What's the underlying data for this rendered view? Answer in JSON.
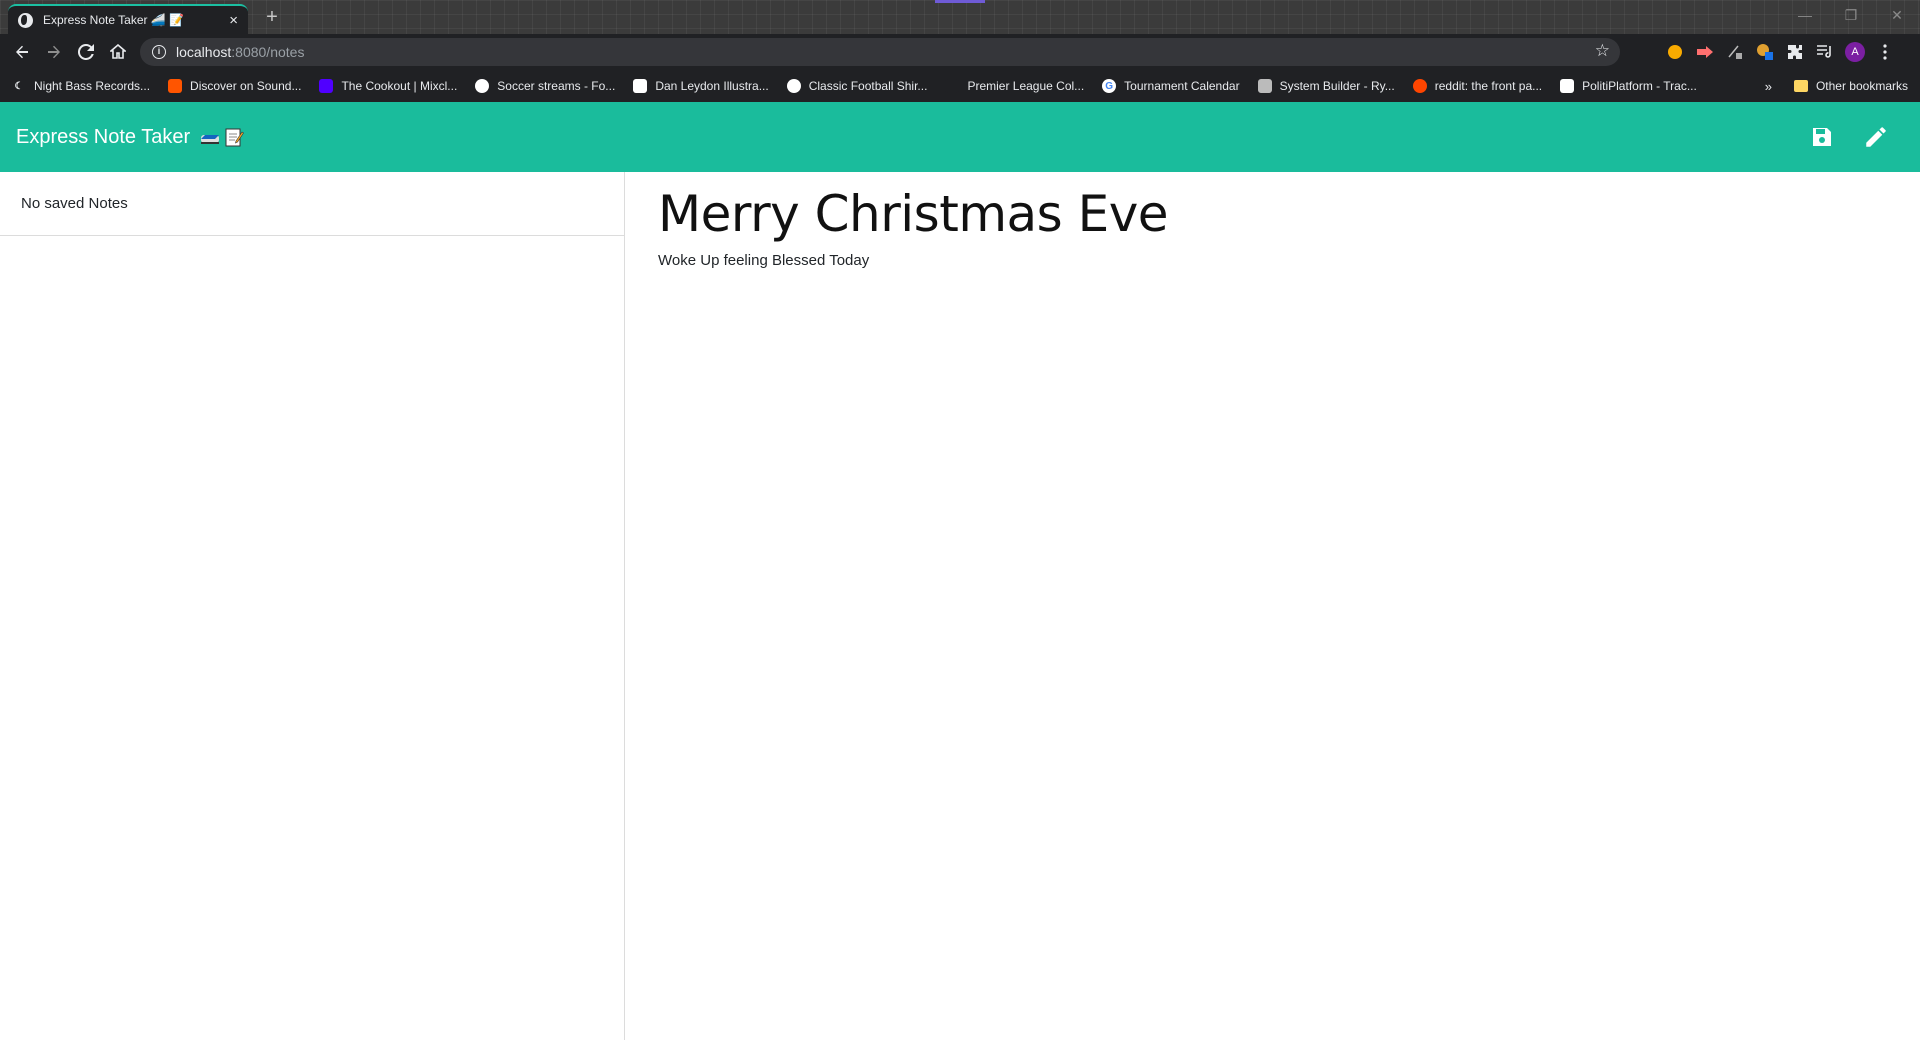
{
  "browser": {
    "tab_title": "Express Note Taker 🚄 📝",
    "new_tab": "+",
    "tab_close": "×",
    "window_controls": [
      "—",
      "❐",
      "✕"
    ],
    "url_host": "localhost",
    "url_path": ":8080/notes",
    "bookmarks": [
      {
        "label": "Night Bass Records...",
        "icon": "moon-icon",
        "color": "#202124"
      },
      {
        "label": "Discover on Sound...",
        "icon": "soundcloud-icon",
        "color": "#ff5500"
      },
      {
        "label": "The Cookout | Mixcl...",
        "icon": "mixcloud-icon",
        "color": "#5000ff"
      },
      {
        "label": "Soccer streams - Fo...",
        "icon": "reddit-ball-icon",
        "color": "#ffffff"
      },
      {
        "label": "Dan Leydon Illustra...",
        "icon": "page-icon",
        "color": "#ffffff"
      },
      {
        "label": "Classic Football Shir...",
        "icon": "football-icon",
        "color": "#ffffff"
      },
      {
        "label": "Premier League Col...",
        "icon": "blank-icon",
        "color": "#202124"
      },
      {
        "label": "Tournament Calendar",
        "icon": "google-icon",
        "color": "#ffffff"
      },
      {
        "label": "System Builder - Ry...",
        "icon": "cube-icon",
        "color": "#bbbbbb"
      },
      {
        "label": "reddit: the front pa...",
        "icon": "reddit-icon",
        "color": "#ff4500"
      },
      {
        "label": "PolitiPlatform - Trac...",
        "icon": "platform-icon",
        "color": "#ffffff"
      }
    ],
    "bookmarks_more": "»",
    "other_bookmarks": "Other bookmarks",
    "avatar_letter": "A"
  },
  "app": {
    "brand": "Express Note Taker",
    "brand_color": "#1abc9c",
    "empty_list": "No saved Notes",
    "note_title": "Merry Christmas Eve",
    "note_text": "Woke Up feeling Blessed Today"
  }
}
